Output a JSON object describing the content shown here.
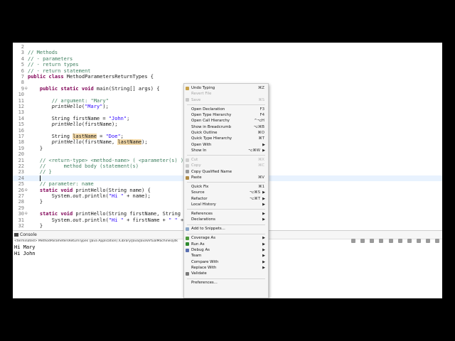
{
  "editor": {
    "lines": [
      {
        "n": "2",
        "fold": "",
        "parts": []
      },
      {
        "n": "3",
        "fold": "",
        "parts": [
          {
            "c": "cm",
            "t": "// Methods"
          }
        ]
      },
      {
        "n": "4",
        "fold": "",
        "parts": [
          {
            "c": "cm",
            "t": "// - parameters"
          }
        ]
      },
      {
        "n": "5",
        "fold": "",
        "parts": [
          {
            "c": "cm",
            "t": "// - return types"
          }
        ]
      },
      {
        "n": "6",
        "fold": "",
        "parts": [
          {
            "c": "cm",
            "t": "// - return statement"
          }
        ]
      },
      {
        "n": "7",
        "fold": "",
        "parts": [
          {
            "c": "kw",
            "t": "public class"
          },
          {
            "c": "",
            "t": " MethodParametersReturnTypes {"
          }
        ]
      },
      {
        "n": "8",
        "fold": "",
        "parts": []
      },
      {
        "n": "9",
        "fold": "⊖",
        "parts": [
          {
            "c": "",
            "t": "    "
          },
          {
            "c": "kw",
            "t": "public static void"
          },
          {
            "c": "",
            "t": " main(String[] args) {"
          }
        ]
      },
      {
        "n": "10",
        "fold": "",
        "parts": []
      },
      {
        "n": "11",
        "fold": "",
        "parts": [
          {
            "c": "",
            "t": "        "
          },
          {
            "c": "cm",
            "t": "// argument: \"Mary\""
          }
        ]
      },
      {
        "n": "12",
        "fold": "",
        "parts": [
          {
            "c": "",
            "t": "        "
          },
          {
            "c": "it",
            "t": "printHello"
          },
          {
            "c": "",
            "t": "("
          },
          {
            "c": "st",
            "t": "\"Mary\""
          },
          {
            "c": "",
            "t": ");"
          }
        ]
      },
      {
        "n": "13",
        "fold": "",
        "parts": []
      },
      {
        "n": "14",
        "fold": "",
        "parts": [
          {
            "c": "",
            "t": "        String firstName = "
          },
          {
            "c": "st",
            "t": "\"John\""
          },
          {
            "c": "",
            "t": ";"
          }
        ]
      },
      {
        "n": "15",
        "fold": "",
        "parts": [
          {
            "c": "",
            "t": "        "
          },
          {
            "c": "it",
            "t": "printHello"
          },
          {
            "c": "",
            "t": "(firstName);"
          }
        ]
      },
      {
        "n": "16",
        "fold": "",
        "parts": []
      },
      {
        "n": "17",
        "fold": "",
        "parts": [
          {
            "c": "",
            "t": "        String "
          },
          {
            "c": "hl",
            "t": "lastName"
          },
          {
            "c": "",
            "t": " = "
          },
          {
            "c": "st",
            "t": "\"Doe\""
          },
          {
            "c": "",
            "t": ";"
          }
        ]
      },
      {
        "n": "18",
        "fold": "",
        "parts": [
          {
            "c": "",
            "t": "        "
          },
          {
            "c": "it",
            "t": "printHello"
          },
          {
            "c": "",
            "t": "(firstName, "
          },
          {
            "c": "hl",
            "t": "lastName"
          },
          {
            "c": "",
            "t": ");"
          }
        ]
      },
      {
        "n": "19",
        "fold": "",
        "parts": [
          {
            "c": "",
            "t": "    }"
          }
        ]
      },
      {
        "n": "20",
        "fold": "",
        "parts": []
      },
      {
        "n": "21",
        "fold": "",
        "parts": [
          {
            "c": "",
            "t": "    "
          },
          {
            "c": "cm",
            "t": "// <return-type> <method-name> ( <parameter(s) )"
          }
        ]
      },
      {
        "n": "22",
        "fold": "",
        "parts": [
          {
            "c": "",
            "t": "    "
          },
          {
            "c": "cm",
            "t": "//      method body (statement(s)"
          }
        ]
      },
      {
        "n": "23",
        "fold": "",
        "parts": [
          {
            "c": "",
            "t": "    "
          },
          {
            "c": "cm",
            "t": "// }"
          }
        ]
      },
      {
        "n": "24",
        "fold": "",
        "cur": true,
        "parts": [
          {
            "c": "",
            "t": "    "
          },
          {
            "c": "caret",
            "t": ""
          }
        ]
      },
      {
        "n": "25",
        "fold": "",
        "parts": [
          {
            "c": "",
            "t": "    "
          },
          {
            "c": "cm",
            "t": "// parameter: name"
          }
        ]
      },
      {
        "n": "26",
        "fold": "⊖",
        "parts": [
          {
            "c": "",
            "t": "    "
          },
          {
            "c": "kw",
            "t": "static void"
          },
          {
            "c": "",
            "t": " printHello(String name) {"
          }
        ]
      },
      {
        "n": "27",
        "fold": "",
        "parts": [
          {
            "c": "",
            "t": "        System."
          },
          {
            "c": "it",
            "t": "out"
          },
          {
            "c": "",
            "t": ".println("
          },
          {
            "c": "st",
            "t": "\"Hi \""
          },
          {
            "c": "",
            "t": " + name);"
          }
        ]
      },
      {
        "n": "28",
        "fold": "",
        "parts": [
          {
            "c": "",
            "t": "    }"
          }
        ]
      },
      {
        "n": "29",
        "fold": "",
        "parts": []
      },
      {
        "n": "30",
        "fold": "⊖",
        "parts": [
          {
            "c": "",
            "t": "    "
          },
          {
            "c": "kw",
            "t": "static void"
          },
          {
            "c": "",
            "t": " printHello(String firstName, String"
          }
        ]
      },
      {
        "n": "31",
        "fold": "",
        "parts": [
          {
            "c": "",
            "t": "        System."
          },
          {
            "c": "it",
            "t": "out"
          },
          {
            "c": "",
            "t": ".println("
          },
          {
            "c": "st",
            "t": "\"Hi \""
          },
          {
            "c": "",
            "t": " + firstName + "
          },
          {
            "c": "st",
            "t": "\" \""
          },
          {
            "c": "",
            "t": " +"
          }
        ]
      },
      {
        "n": "32",
        "fold": "",
        "parts": [
          {
            "c": "",
            "t": "    }"
          }
        ]
      }
    ]
  },
  "console": {
    "tab_label": "Console",
    "status": "<terminated> MethodParametersReturnTypes [Java Application] /Library/Java/JavaVirtualMachines/jdk",
    "status_time": "3:08:02 PM)",
    "output": [
      "Hi Mary",
      "Hi John"
    ]
  },
  "context_menu": {
    "items": [
      {
        "label": "Undo Typing",
        "shortcut": "⌘Z",
        "icon": "undo-icon",
        "icolor": "#c9a24a"
      },
      {
        "label": "Revert File",
        "disabled": true
      },
      {
        "label": "Save",
        "shortcut": "⌘S",
        "disabled": true,
        "icon": "save-icon",
        "icolor": "#c9c9c9"
      },
      {
        "sep": true
      },
      {
        "label": "Open Declaration",
        "shortcut": "F3"
      },
      {
        "label": "Open Type Hierarchy",
        "shortcut": "F4"
      },
      {
        "label": "Open Call Hierarchy",
        "shortcut": "^⌥H"
      },
      {
        "label": "Show in Breadcrumb",
        "shortcut": "⌥⌘B"
      },
      {
        "label": "Quick Outline",
        "shortcut": "⌘O"
      },
      {
        "label": "Quick Type Hierarchy",
        "shortcut": "⌘T"
      },
      {
        "label": "Open With",
        "submenu": true
      },
      {
        "label": "Show In",
        "shortcut": "⌥⌘W",
        "submenu": true
      },
      {
        "sep": true
      },
      {
        "label": "Cut",
        "shortcut": "⌘X",
        "disabled": true,
        "icon": "cut-icon",
        "icolor": "#cfcfcf"
      },
      {
        "label": "Copy",
        "shortcut": "⌘C",
        "disabled": true,
        "icon": "copy-icon",
        "icolor": "#cfcfcf"
      },
      {
        "label": "Copy Qualified Name",
        "icon": "copy-name-icon",
        "icolor": "#9a9a9a"
      },
      {
        "label": "Paste",
        "shortcut": "⌘V",
        "icon": "paste-icon",
        "icolor": "#b08a45"
      },
      {
        "sep": true
      },
      {
        "label": "Quick Fix",
        "shortcut": "⌘1"
      },
      {
        "label": "Source",
        "shortcut": "⌥⌘S",
        "submenu": true
      },
      {
        "label": "Refactor",
        "shortcut": "⌥⌘T",
        "submenu": true
      },
      {
        "label": "Local History",
        "submenu": true
      },
      {
        "sep": true
      },
      {
        "label": "References",
        "submenu": true
      },
      {
        "label": "Declarations",
        "submenu": true
      },
      {
        "sep": true
      },
      {
        "label": "Add to Snippets...",
        "icon": "snippets-icon",
        "icolor": "#8aa6c8"
      },
      {
        "sep": true
      },
      {
        "label": "Coverage As",
        "submenu": true,
        "icon": "coverage-icon",
        "icolor": "#4c9a3c"
      },
      {
        "label": "Run As",
        "submenu": true,
        "icon": "run-icon",
        "icolor": "#2f8a2f"
      },
      {
        "label": "Debug As",
        "submenu": true,
        "icon": "debug-icon",
        "icolor": "#5a6fb0"
      },
      {
        "label": "Team",
        "submenu": true
      },
      {
        "label": "Compare With",
        "submenu": true
      },
      {
        "label": "Replace With",
        "submenu": true
      },
      {
        "label": "Validate",
        "icon": "checkbox-icon",
        "icolor": "#7a7a7a"
      },
      {
        "sep": true
      },
      {
        "label": "Preferences..."
      }
    ]
  }
}
